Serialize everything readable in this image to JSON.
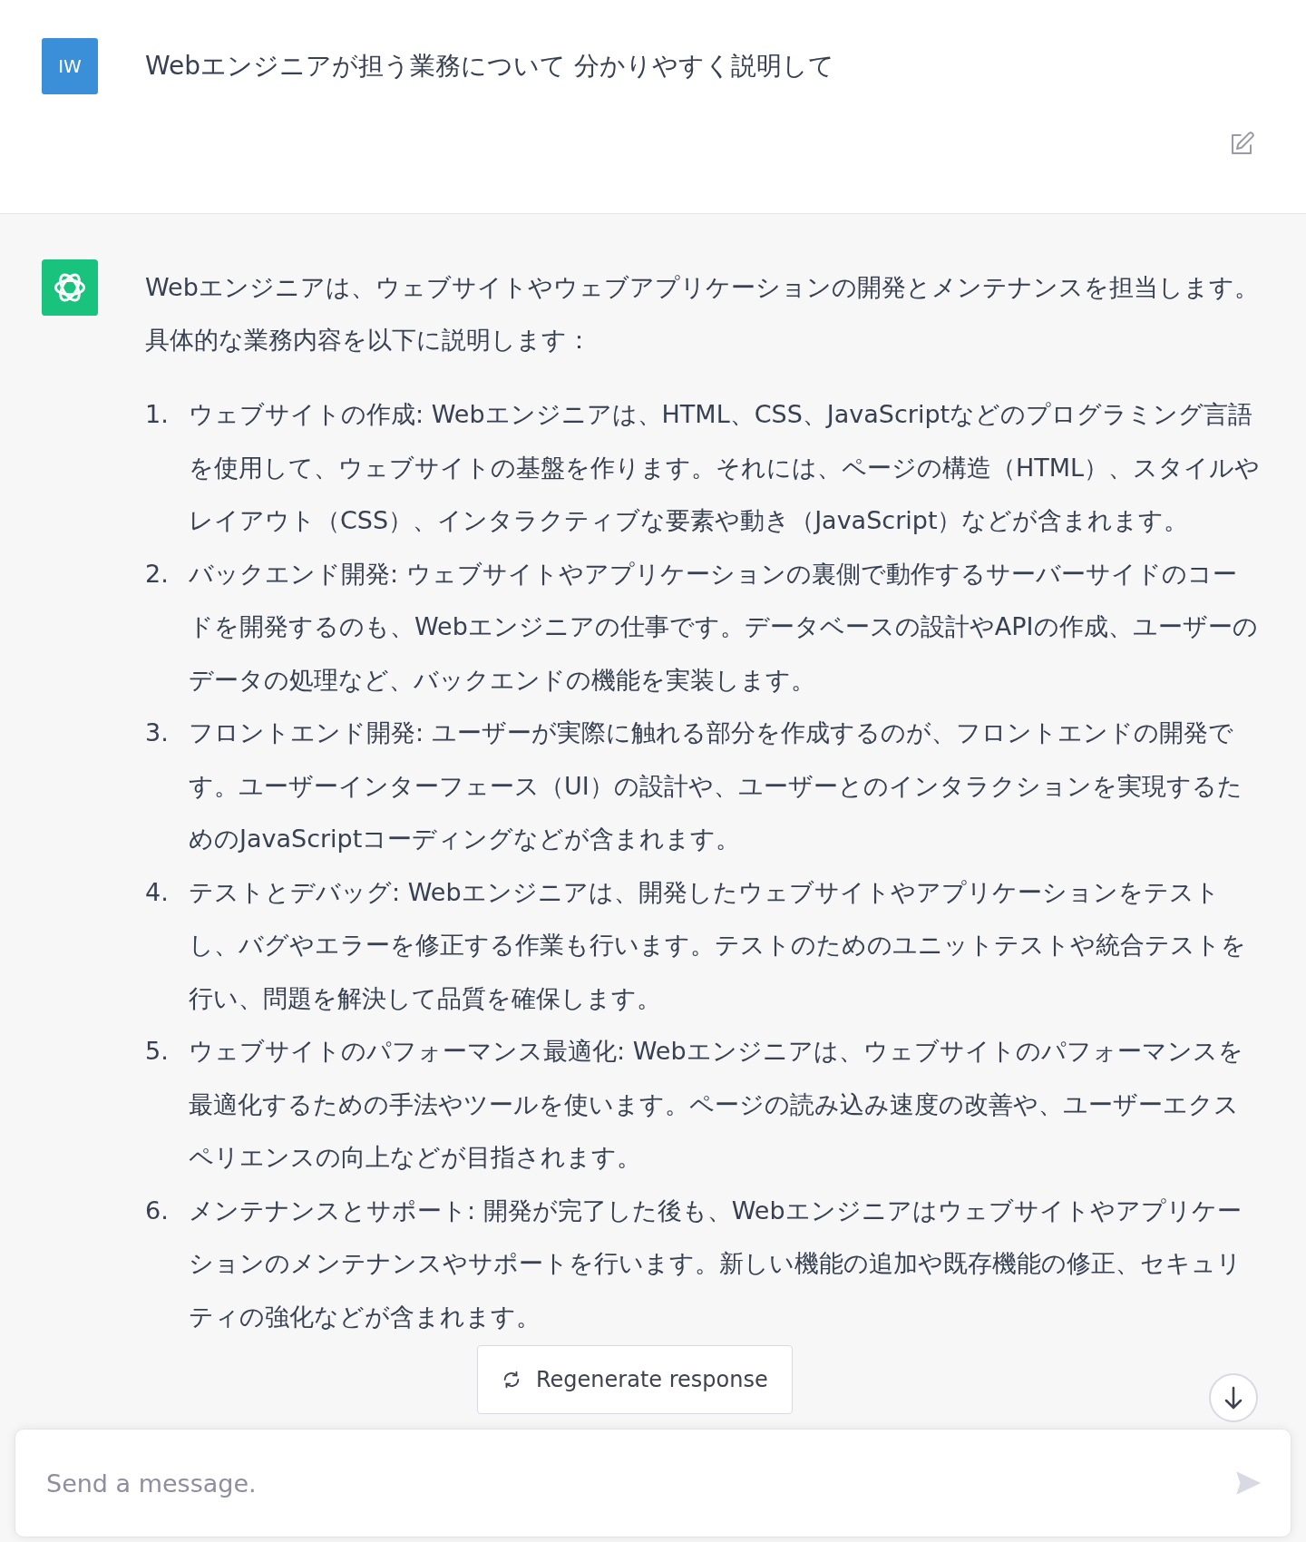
{
  "user_message": {
    "avatar": "IW",
    "text": "Webエンジニアが担う業務について 分かりやすく説明して"
  },
  "assistant_message": {
    "intro": "Webエンジニアは、ウェブサイトやウェブアプリケーションの開発とメンテナンスを担当します。具体的な業務内容を以下に説明します：",
    "items": [
      {
        "number": "1.",
        "text": "ウェブサイトの作成: Webエンジニアは、HTML、CSS、JavaScriptなどのプログラミング言語を使用して、ウェブサイトの基盤を作ります。それには、ページの構造（HTML）、スタイルやレイアウト（CSS）、インタラクティブな要素や動き（JavaScript）などが含まれます。"
      },
      {
        "number": "2.",
        "text": "バックエンド開発: ウェブサイトやアプリケーションの裏側で動作するサーバーサイドのコードを開発するのも、Webエンジニアの仕事です。データベースの設計やAPIの作成、ユーザーのデータの処理など、バックエンドの機能を実装します。"
      },
      {
        "number": "3.",
        "text": "フロントエンド開発: ユーザーが実際に触れる部分を作成するのが、フロントエンドの開発です。ユーザーインターフェース（UI）の設計や、ユーザーとのインタラクションを実現するためのJavaScriptコーディングなどが含まれます。"
      },
      {
        "number": "4.",
        "text": "テストとデバッグ: Webエンジニアは、開発したウェブサイトやアプリケーションをテストし、バグやエラーを修正する作業も行います。テストのためのユニットテストや統合テストを行い、問題を解決して品質を確保します。"
      },
      {
        "number": "5.",
        "text": "ウェブサイトのパフォーマンス最適化: Webエンジニアは、ウェブサイトのパフォーマンスを最適化するための手法やツールを使います。ページの読み込み速度の改善や、ユーザーエクスペリエンスの向上などが目指されます。"
      },
      {
        "number": "6.",
        "text": "メンテナンスとサポート: 開発が完了した後も、Webエンジニアはウェブサイトやアプリケーションのメンテナンスやサポートを行います。新しい機能の追加や既存機能の修正、セキュリティの強化などが含まれます。"
      }
    ]
  },
  "regenerate_button": {
    "label": "Regenerate response"
  },
  "composer": {
    "placeholder": "Send a message."
  }
}
